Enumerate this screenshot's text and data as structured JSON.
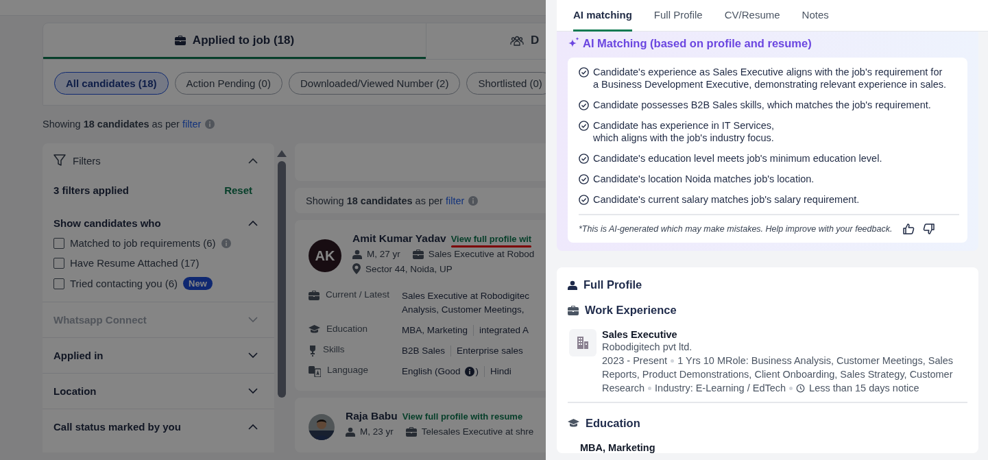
{
  "main_tabs": [
    {
      "label": "Applied to job (18)",
      "selected": true
    },
    {
      "label": "D",
      "selected": false
    }
  ],
  "filter_pills": [
    {
      "label": "All candidates (18)",
      "selected": true
    },
    {
      "label": "Action Pending (0)",
      "selected": false
    },
    {
      "label": "Downloaded/Viewed Number (2)",
      "selected": false
    },
    {
      "label": "Shortlisted (0)",
      "selected": false
    }
  ],
  "summary": {
    "text": "Showing **18 candidates** as per",
    "link": "filter"
  },
  "filters": {
    "title": "Filters",
    "expanded": true,
    "applied": "3  filters applied",
    "reset": "Reset",
    "sections": [
      {
        "title": "Show candidates who",
        "expanded": true,
        "disabled": false,
        "options": [
          {
            "label": "Matched to job requirements (6)",
            "checked": false,
            "info": true
          },
          {
            "label": "Have Resume Attached (17)",
            "checked": false,
            "info": false
          },
          {
            "label": "Tried contacting you (6)",
            "checked": false,
            "info": false,
            "badge": "New"
          }
        ]
      },
      {
        "title": "Whatsapp Connect",
        "expanded": false,
        "disabled": true
      },
      {
        "title": "Applied in",
        "expanded": false,
        "disabled": false
      },
      {
        "title": "Location",
        "expanded": false,
        "disabled": false
      },
      {
        "title": "Call status marked by you",
        "expanded": true,
        "disabled": false
      }
    ]
  },
  "results": {
    "summary": {
      "text": "Showing **18 candidates** as per",
      "link": "filter"
    },
    "candidates": [
      {
        "avatar": {
          "kind": "initials",
          "text": "AK"
        },
        "name": "Amit Kumar Yadav",
        "link": "View full profile wit",
        "annotated": true,
        "gender_age": "M, 27 yr",
        "current": "Sales Executive at Robod",
        "location": "Sector 44, Noida, UP",
        "details": [
          {
            "kind": "briefcase",
            "label": "Current / Latest",
            "lines": [
              "Sales Executive at Robodigitec",
              "Analysis, Customer Meetings,"
            ]
          },
          {
            "kind": "education",
            "label": "Education",
            "values": [
              "MBA, Marketing",
              "integrated A"
            ]
          },
          {
            "kind": "skills",
            "label": "Skills",
            "values": [
              "B2B Sales",
              "Enterprise sales"
            ]
          },
          {
            "kind": "language",
            "label": "Language",
            "values": [
              "English (Good",
              "Hindi"
            ],
            "info_after": ")"
          }
        ]
      },
      {
        "name": "Raja Babu",
        "link": "View full profile with resume",
        "annotated": false,
        "gender_age": "M, 23 yr",
        "current": "Telesales Executive at shre"
      }
    ]
  },
  "drawer": {
    "tabs": [
      {
        "label": "AI matching",
        "selected": true
      },
      {
        "label": "Full Profile",
        "selected": false
      },
      {
        "label": "CV/Resume",
        "selected": false
      },
      {
        "label": "Notes",
        "selected": false
      }
    ],
    "ai": {
      "title": "AI Matching (based on profile and resume)",
      "points": [
        [
          "Candidate's experience as Sales Executive aligns with the job's requirement for",
          "a Business Development Executive, demonstrating relevant experience in sales."
        ],
        [
          "Candidate possesses B2B Sales skills, which matches the job's requirement."
        ],
        [
          "Candidate has experience in IT Services,",
          "which aligns with the job's industry focus."
        ],
        [
          "Candidate's education level meets job's minimum education level."
        ],
        [
          "Candidate's location Noida matches job's location."
        ],
        [
          "Candidate's current salary matches job's salary requirement."
        ]
      ],
      "disclaimer": "*This is AI-generated which may make mistakes. Help improve with your feedback."
    },
    "profile": {
      "title": "Full Profile",
      "work_title": "Work Experience",
      "jobs": [
        {
          "role": "Sales Executive",
          "company": "Robodigitech pvt ltd.",
          "segments": [
            "2023 - Present",
            "1 Yrs 10 MRole: Business Analysis, Customer Meetings, Sales Reports, Product Demonstrations, Client Onboarding, Sales Strategy, Customer Research",
            "Industry: E-Learning / EdTech"
          ],
          "notice": "Less than 15 days notice"
        }
      ],
      "education_title": "Education",
      "degree": "MBA, Marketing"
    }
  }
}
